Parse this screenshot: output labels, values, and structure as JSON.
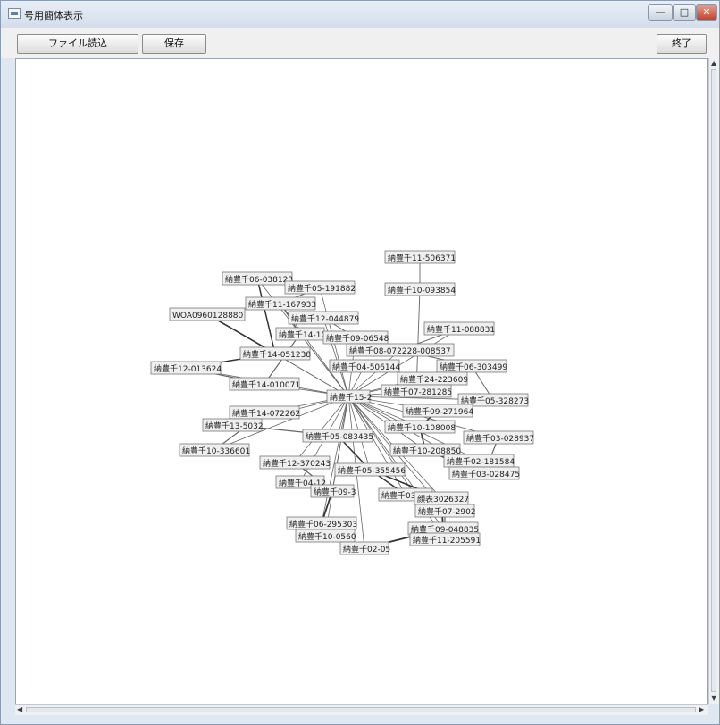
{
  "window": {
    "title": "号用簡体表示"
  },
  "window_controls": {
    "minimize": "—",
    "maximize": "□",
    "close": "✕"
  },
  "toolbar": {
    "load_label": "ファイル読込",
    "save_label": "保存",
    "exit_label": "終了"
  },
  "scrollbar": {
    "up": "▲",
    "down": "▼",
    "left": "◀",
    "right": "▶"
  },
  "graph": {
    "nodes": [
      "納豊千11-506371",
      "納豊千10-093854",
      "納豊千06-038123",
      "納豊千05-191882",
      "納豊千11-167933",
      "WOA0960128880",
      "納豊千12-044879",
      "納豊千14-10",
      "納豊千09-06548",
      "納豊千11-088831",
      "納豊千08-072228-008537",
      "納豊千14-051238",
      "納豊千12-013624",
      "納豊千04-506144",
      "納豊千06-303499",
      "納豊千24-223609",
      "納豊千14-010071",
      "納豊千07-281285",
      "納豊千15-2",
      "納豊千05-328273",
      "納豊千09-271964",
      "納豊千14-072262",
      "納豊千13-5032",
      "納豊千10-108008",
      "納豊千05-083435",
      "納豊千03-028937",
      "納豊千10-336601",
      "納豊千10-208850",
      "納豊千02-181584",
      "納豊千12-370243",
      "納豊千03-028475",
      "納豊千05-355456",
      "納豊千04-12",
      "納豊千09-3",
      "納豊千03-012",
      "顔表3026327",
      "納豊千07-2902",
      "納豊千06-295303",
      "納豊千09-048835",
      "納豊千10-0560",
      "納豊千11-205591",
      "納豊千02-05"
    ]
  }
}
